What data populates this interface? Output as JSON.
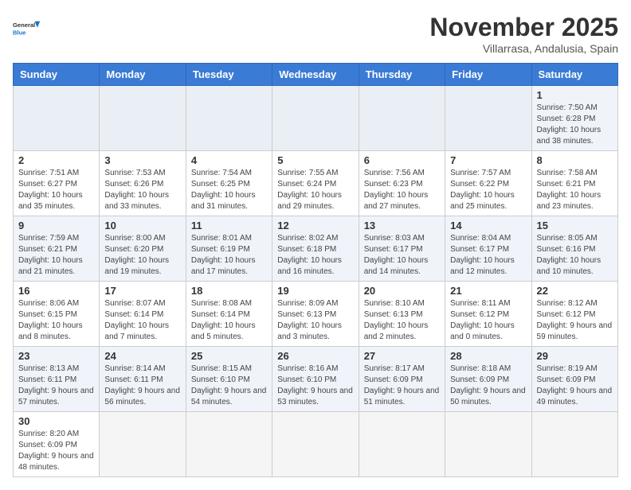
{
  "header": {
    "logo_general": "General",
    "logo_blue": "Blue",
    "month_title": "November 2025",
    "location": "Villarrasa, Andalusia, Spain"
  },
  "weekdays": [
    "Sunday",
    "Monday",
    "Tuesday",
    "Wednesday",
    "Thursday",
    "Friday",
    "Saturday"
  ],
  "weeks": [
    [
      {
        "day": "",
        "info": ""
      },
      {
        "day": "",
        "info": ""
      },
      {
        "day": "",
        "info": ""
      },
      {
        "day": "",
        "info": ""
      },
      {
        "day": "",
        "info": ""
      },
      {
        "day": "",
        "info": ""
      },
      {
        "day": "1",
        "info": "Sunrise: 7:50 AM\nSunset: 6:28 PM\nDaylight: 10 hours and 38 minutes."
      }
    ],
    [
      {
        "day": "2",
        "info": "Sunrise: 7:51 AM\nSunset: 6:27 PM\nDaylight: 10 hours and 35 minutes."
      },
      {
        "day": "3",
        "info": "Sunrise: 7:53 AM\nSunset: 6:26 PM\nDaylight: 10 hours and 33 minutes."
      },
      {
        "day": "4",
        "info": "Sunrise: 7:54 AM\nSunset: 6:25 PM\nDaylight: 10 hours and 31 minutes."
      },
      {
        "day": "5",
        "info": "Sunrise: 7:55 AM\nSunset: 6:24 PM\nDaylight: 10 hours and 29 minutes."
      },
      {
        "day": "6",
        "info": "Sunrise: 7:56 AM\nSunset: 6:23 PM\nDaylight: 10 hours and 27 minutes."
      },
      {
        "day": "7",
        "info": "Sunrise: 7:57 AM\nSunset: 6:22 PM\nDaylight: 10 hours and 25 minutes."
      },
      {
        "day": "8",
        "info": "Sunrise: 7:58 AM\nSunset: 6:21 PM\nDaylight: 10 hours and 23 minutes."
      }
    ],
    [
      {
        "day": "9",
        "info": "Sunrise: 7:59 AM\nSunset: 6:21 PM\nDaylight: 10 hours and 21 minutes."
      },
      {
        "day": "10",
        "info": "Sunrise: 8:00 AM\nSunset: 6:20 PM\nDaylight: 10 hours and 19 minutes."
      },
      {
        "day": "11",
        "info": "Sunrise: 8:01 AM\nSunset: 6:19 PM\nDaylight: 10 hours and 17 minutes."
      },
      {
        "day": "12",
        "info": "Sunrise: 8:02 AM\nSunset: 6:18 PM\nDaylight: 10 hours and 16 minutes."
      },
      {
        "day": "13",
        "info": "Sunrise: 8:03 AM\nSunset: 6:17 PM\nDaylight: 10 hours and 14 minutes."
      },
      {
        "day": "14",
        "info": "Sunrise: 8:04 AM\nSunset: 6:17 PM\nDaylight: 10 hours and 12 minutes."
      },
      {
        "day": "15",
        "info": "Sunrise: 8:05 AM\nSunset: 6:16 PM\nDaylight: 10 hours and 10 minutes."
      }
    ],
    [
      {
        "day": "16",
        "info": "Sunrise: 8:06 AM\nSunset: 6:15 PM\nDaylight: 10 hours and 8 minutes."
      },
      {
        "day": "17",
        "info": "Sunrise: 8:07 AM\nSunset: 6:14 PM\nDaylight: 10 hours and 7 minutes."
      },
      {
        "day": "18",
        "info": "Sunrise: 8:08 AM\nSunset: 6:14 PM\nDaylight: 10 hours and 5 minutes."
      },
      {
        "day": "19",
        "info": "Sunrise: 8:09 AM\nSunset: 6:13 PM\nDaylight: 10 hours and 3 minutes."
      },
      {
        "day": "20",
        "info": "Sunrise: 8:10 AM\nSunset: 6:13 PM\nDaylight: 10 hours and 2 minutes."
      },
      {
        "day": "21",
        "info": "Sunrise: 8:11 AM\nSunset: 6:12 PM\nDaylight: 10 hours and 0 minutes."
      },
      {
        "day": "22",
        "info": "Sunrise: 8:12 AM\nSunset: 6:12 PM\nDaylight: 9 hours and 59 minutes."
      }
    ],
    [
      {
        "day": "23",
        "info": "Sunrise: 8:13 AM\nSunset: 6:11 PM\nDaylight: 9 hours and 57 minutes."
      },
      {
        "day": "24",
        "info": "Sunrise: 8:14 AM\nSunset: 6:11 PM\nDaylight: 9 hours and 56 minutes."
      },
      {
        "day": "25",
        "info": "Sunrise: 8:15 AM\nSunset: 6:10 PM\nDaylight: 9 hours and 54 minutes."
      },
      {
        "day": "26",
        "info": "Sunrise: 8:16 AM\nSunset: 6:10 PM\nDaylight: 9 hours and 53 minutes."
      },
      {
        "day": "27",
        "info": "Sunrise: 8:17 AM\nSunset: 6:09 PM\nDaylight: 9 hours and 51 minutes."
      },
      {
        "day": "28",
        "info": "Sunrise: 8:18 AM\nSunset: 6:09 PM\nDaylight: 9 hours and 50 minutes."
      },
      {
        "day": "29",
        "info": "Sunrise: 8:19 AM\nSunset: 6:09 PM\nDaylight: 9 hours and 49 minutes."
      }
    ],
    [
      {
        "day": "30",
        "info": "Sunrise: 8:20 AM\nSunset: 6:09 PM\nDaylight: 9 hours and 48 minutes."
      },
      {
        "day": "",
        "info": ""
      },
      {
        "day": "",
        "info": ""
      },
      {
        "day": "",
        "info": ""
      },
      {
        "day": "",
        "info": ""
      },
      {
        "day": "",
        "info": ""
      },
      {
        "day": "",
        "info": ""
      }
    ]
  ]
}
